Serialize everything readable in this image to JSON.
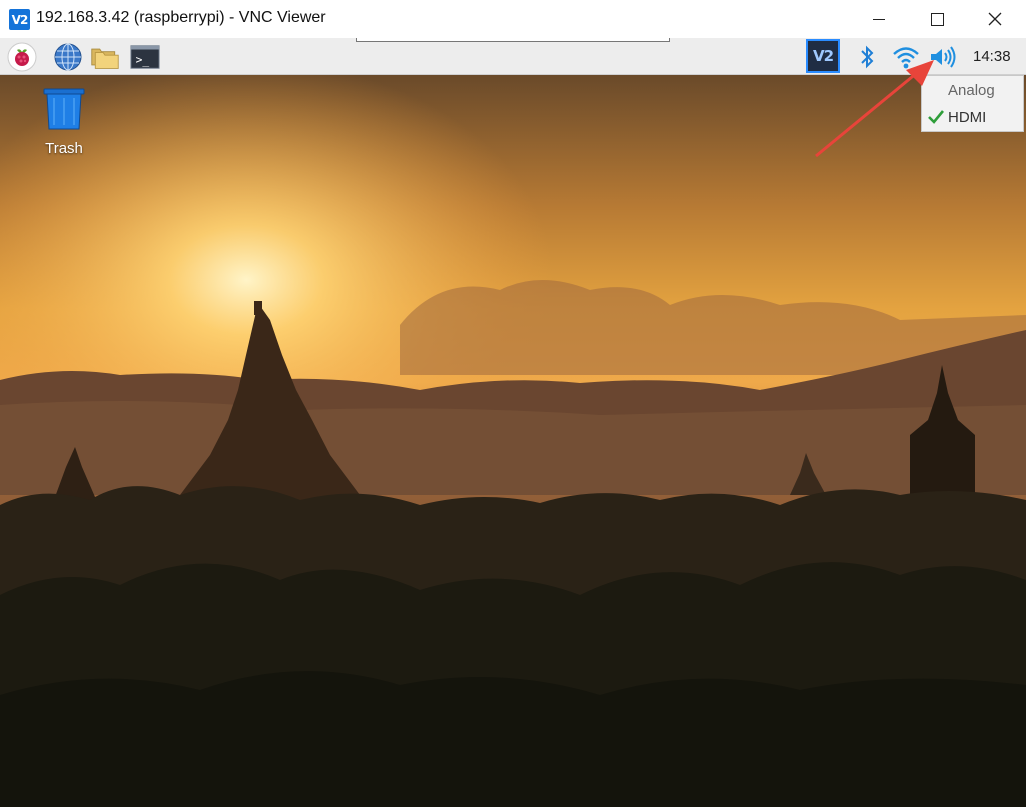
{
  "window": {
    "app_icon_text": "V2",
    "title": "192.168.3.42 (raspberrypi) - VNC Viewer",
    "controls": [
      "minimize",
      "maximize",
      "close"
    ]
  },
  "taskbar": {
    "launchers": [
      {
        "name": "raspberry-menu",
        "icon": "raspberry-icon"
      },
      {
        "name": "web-browser",
        "icon": "globe-icon"
      },
      {
        "name": "file-manager",
        "icon": "folders-icon"
      },
      {
        "name": "terminal",
        "icon": "terminal-icon",
        "text": ">_"
      }
    ],
    "tray": {
      "vnc_icon_text": "V2",
      "bluetooth": "bluetooth-icon",
      "wifi": "wifi-icon",
      "volume": "volume-icon",
      "clock": "14:38"
    }
  },
  "desktop": {
    "trash_label": "Trash"
  },
  "audio_menu": {
    "items": [
      {
        "label": "Analog",
        "checked": false
      },
      {
        "label": "HDMI",
        "checked": true
      }
    ]
  },
  "colors": {
    "annotation_arrow": "#e8443a",
    "accent_blue": "#1473d9",
    "check_green": "#2e9e3a"
  }
}
